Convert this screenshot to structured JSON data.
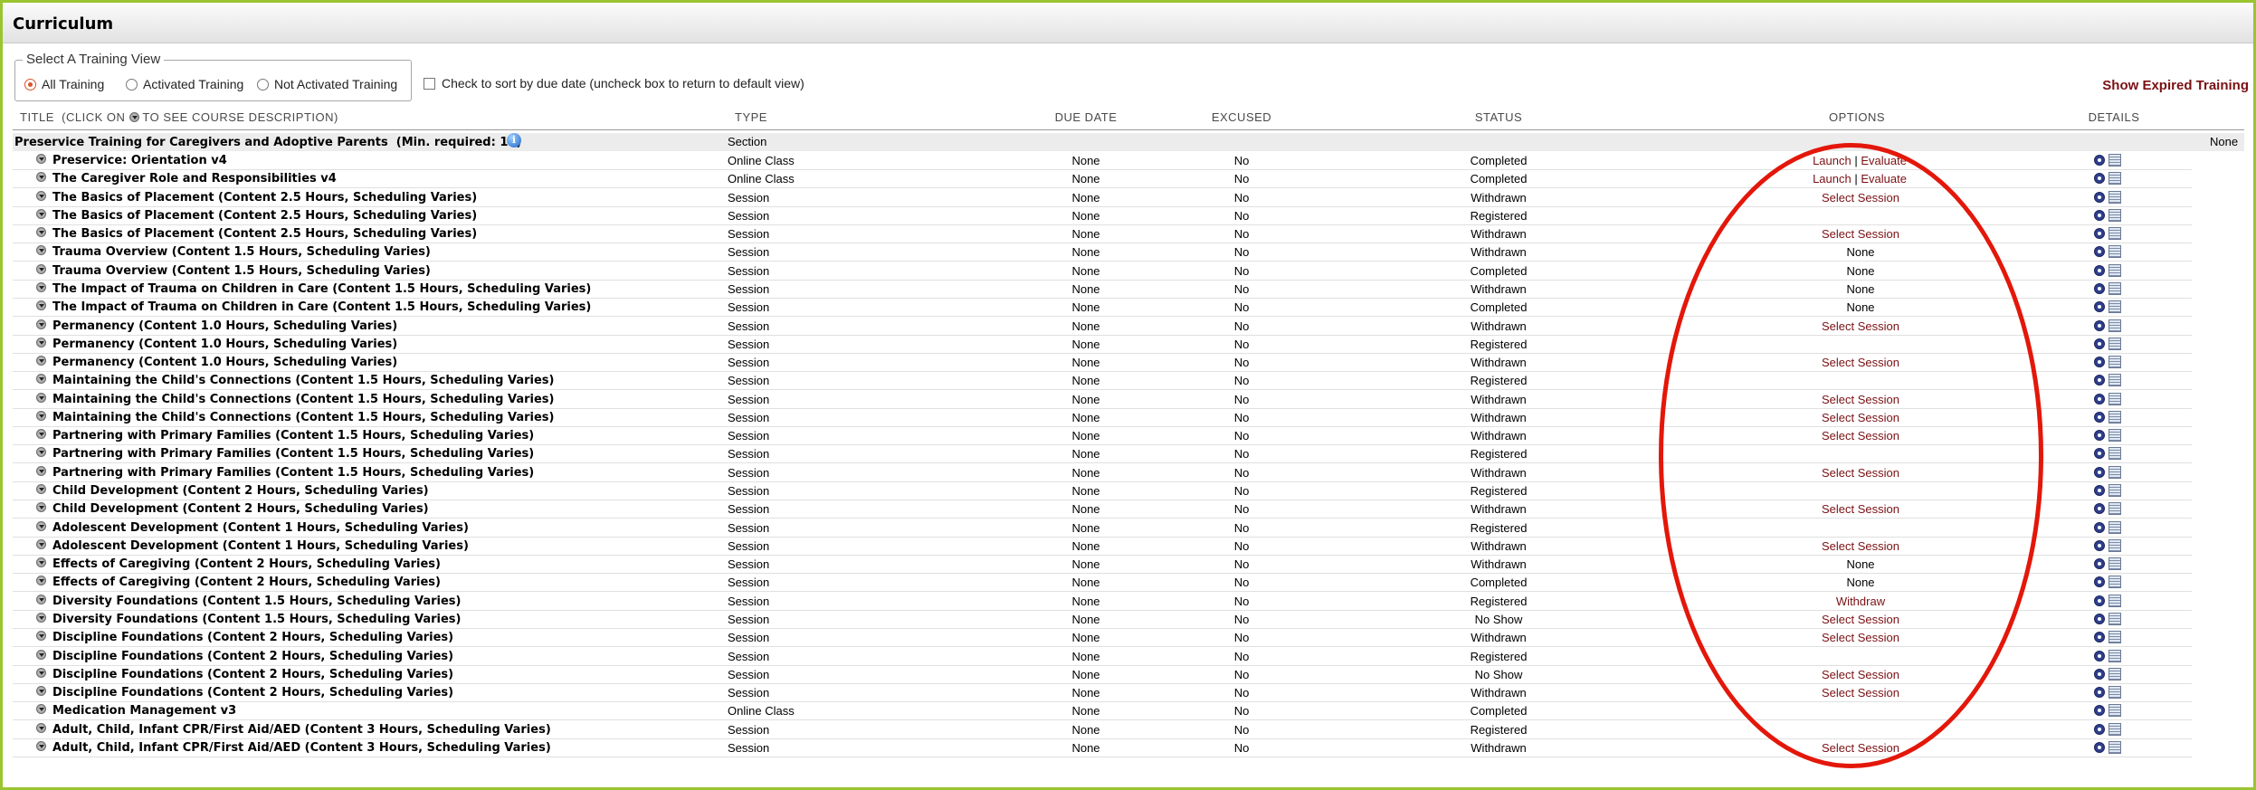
{
  "window": {
    "title": "Curriculum"
  },
  "view_selector": {
    "legend": "Select A Training View",
    "options": [
      {
        "label": "All Training",
        "selected": true
      },
      {
        "label": "Activated Training",
        "selected": false
      },
      {
        "label": "Not Activated Training",
        "selected": false
      }
    ]
  },
  "sort_checkbox": {
    "label": "Check to sort by due date (uncheck box to return to default view)",
    "checked": false
  },
  "show_expired_label": "Show Expired Training",
  "columns": {
    "title_prefix": "TITLE",
    "title_hint_a": "(CLICK ON",
    "title_hint_b": "TO SEE COURSE DESCRIPTION)",
    "type": "TYPE",
    "due_date": "DUE DATE",
    "excused": "EXCUSED",
    "status": "STATUS",
    "options": "OPTIONS",
    "details": "DETAILS"
  },
  "section": {
    "title": "Preservice Training for Caregivers and Adoptive Parents",
    "min_required": "(Min. required: 15)",
    "type": "Section",
    "details": "None"
  },
  "rows": [
    {
      "title": "Preservice: Orientation v4",
      "type": "Online Class",
      "due": "None",
      "excused": "No",
      "status": "Completed",
      "options": [
        "Launch",
        "Evaluate"
      ]
    },
    {
      "title": "The Caregiver Role and Responsibilities v4",
      "type": "Online Class",
      "due": "None",
      "excused": "No",
      "status": "Completed",
      "options": [
        "Launch",
        "Evaluate"
      ]
    },
    {
      "title": "The Basics of Placement (Content 2.5 Hours, Scheduling Varies)",
      "type": "Session",
      "due": "None",
      "excused": "No",
      "status": "Withdrawn",
      "options": [
        "Select Session"
      ]
    },
    {
      "title": "The Basics of Placement (Content 2.5 Hours, Scheduling Varies)",
      "type": "Session",
      "due": "None",
      "excused": "No",
      "status": "Registered",
      "options": []
    },
    {
      "title": "The Basics of Placement (Content 2.5 Hours, Scheduling Varies)",
      "type": "Session",
      "due": "None",
      "excused": "No",
      "status": "Withdrawn",
      "options": [
        "Select Session"
      ]
    },
    {
      "title": "Trauma Overview (Content 1.5 Hours, Scheduling Varies)",
      "type": "Session",
      "due": "None",
      "excused": "No",
      "status": "Withdrawn",
      "options_plain": "None"
    },
    {
      "title": "Trauma Overview (Content 1.5 Hours, Scheduling Varies)",
      "type": "Session",
      "due": "None",
      "excused": "No",
      "status": "Completed",
      "options_plain": "None"
    },
    {
      "title": "The Impact of Trauma on Children in Care (Content 1.5 Hours, Scheduling Varies)",
      "type": "Session",
      "due": "None",
      "excused": "No",
      "status": "Withdrawn",
      "options_plain": "None"
    },
    {
      "title": "The Impact of Trauma on Children in Care (Content 1.5 Hours, Scheduling Varies)",
      "type": "Session",
      "due": "None",
      "excused": "No",
      "status": "Completed",
      "options_plain": "None"
    },
    {
      "title": "Permanency (Content 1.0 Hours, Scheduling Varies)",
      "type": "Session",
      "due": "None",
      "excused": "No",
      "status": "Withdrawn",
      "options": [
        "Select Session"
      ]
    },
    {
      "title": "Permanency (Content 1.0 Hours, Scheduling Varies)",
      "type": "Session",
      "due": "None",
      "excused": "No",
      "status": "Registered",
      "options": []
    },
    {
      "title": "Permanency (Content 1.0 Hours, Scheduling Varies)",
      "type": "Session",
      "due": "None",
      "excused": "No",
      "status": "Withdrawn",
      "options": [
        "Select Session"
      ]
    },
    {
      "title": "Maintaining the Child's Connections (Content 1.5 Hours, Scheduling Varies)",
      "type": "Session",
      "due": "None",
      "excused": "No",
      "status": "Registered",
      "options": []
    },
    {
      "title": "Maintaining the Child's Connections (Content 1.5 Hours, Scheduling Varies)",
      "type": "Session",
      "due": "None",
      "excused": "No",
      "status": "Withdrawn",
      "options": [
        "Select Session"
      ]
    },
    {
      "title": "Maintaining the Child's Connections (Content 1.5 Hours, Scheduling Varies)",
      "type": "Session",
      "due": "None",
      "excused": "No",
      "status": "Withdrawn",
      "options": [
        "Select Session"
      ]
    },
    {
      "title": "Partnering with Primary Families (Content 1.5 Hours, Scheduling Varies)",
      "type": "Session",
      "due": "None",
      "excused": "No",
      "status": "Withdrawn",
      "options": [
        "Select Session"
      ]
    },
    {
      "title": "Partnering with Primary Families (Content 1.5 Hours, Scheduling Varies)",
      "type": "Session",
      "due": "None",
      "excused": "No",
      "status": "Registered",
      "options": []
    },
    {
      "title": "Partnering with Primary Families (Content 1.5 Hours, Scheduling Varies)",
      "type": "Session",
      "due": "None",
      "excused": "No",
      "status": "Withdrawn",
      "options": [
        "Select Session"
      ]
    },
    {
      "title": "Child Development (Content 2 Hours, Scheduling Varies)",
      "type": "Session",
      "due": "None",
      "excused": "No",
      "status": "Registered",
      "options": []
    },
    {
      "title": "Child Development (Content 2 Hours, Scheduling Varies)",
      "type": "Session",
      "due": "None",
      "excused": "No",
      "status": "Withdrawn",
      "options": [
        "Select Session"
      ]
    },
    {
      "title": "Adolescent Development (Content 1 Hours, Scheduling Varies)",
      "type": "Session",
      "due": "None",
      "excused": "No",
      "status": "Registered",
      "options": []
    },
    {
      "title": "Adolescent Development (Content 1 Hours, Scheduling Varies)",
      "type": "Session",
      "due": "None",
      "excused": "No",
      "status": "Withdrawn",
      "options": [
        "Select Session"
      ]
    },
    {
      "title": "Effects of Caregiving (Content 2 Hours, Scheduling Varies)",
      "type": "Session",
      "due": "None",
      "excused": "No",
      "status": "Withdrawn",
      "options_plain": "None"
    },
    {
      "title": "Effects of Caregiving (Content 2 Hours, Scheduling Varies)",
      "type": "Session",
      "due": "None",
      "excused": "No",
      "status": "Completed",
      "options_plain": "None"
    },
    {
      "title": "Diversity Foundations (Content 1.5 Hours, Scheduling Varies)",
      "type": "Session",
      "due": "None",
      "excused": "No",
      "status": "Registered",
      "options": [
        "Withdraw"
      ]
    },
    {
      "title": "Diversity Foundations (Content 1.5 Hours, Scheduling Varies)",
      "type": "Session",
      "due": "None",
      "excused": "No",
      "status": "No Show",
      "options": [
        "Select Session"
      ]
    },
    {
      "title": "Discipline Foundations (Content 2 Hours, Scheduling Varies)",
      "type": "Session",
      "due": "None",
      "excused": "No",
      "status": "Withdrawn",
      "options": [
        "Select Session"
      ]
    },
    {
      "title": "Discipline Foundations (Content 2 Hours, Scheduling Varies)",
      "type": "Session",
      "due": "None",
      "excused": "No",
      "status": "Registered",
      "options": []
    },
    {
      "title": "Discipline Foundations (Content 2 Hours, Scheduling Varies)",
      "type": "Session",
      "due": "None",
      "excused": "No",
      "status": "No Show",
      "options": [
        "Select Session"
      ]
    },
    {
      "title": "Discipline Foundations (Content 2 Hours, Scheduling Varies)",
      "type": "Session",
      "due": "None",
      "excused": "No",
      "status": "Withdrawn",
      "options": [
        "Select Session"
      ]
    },
    {
      "title": "Medication Management v3",
      "type": "Online Class",
      "due": "None",
      "excused": "No",
      "status": "Completed",
      "options": []
    },
    {
      "title": "Adult, Child, Infant CPR/First Aid/AED (Content 3 Hours, Scheduling Varies)",
      "type": "Session",
      "due": "None",
      "excused": "No",
      "status": "Registered",
      "options": []
    },
    {
      "title": "Adult, Child, Infant CPR/First Aid/AED (Content 3 Hours, Scheduling Varies)",
      "type": "Session",
      "due": "None",
      "excused": "No",
      "status": "Withdrawn",
      "options": [
        "Select Session"
      ]
    }
  ],
  "colors": {
    "link": "#7a1114",
    "frame": "#9bc431",
    "annotation": "#e3170a"
  }
}
